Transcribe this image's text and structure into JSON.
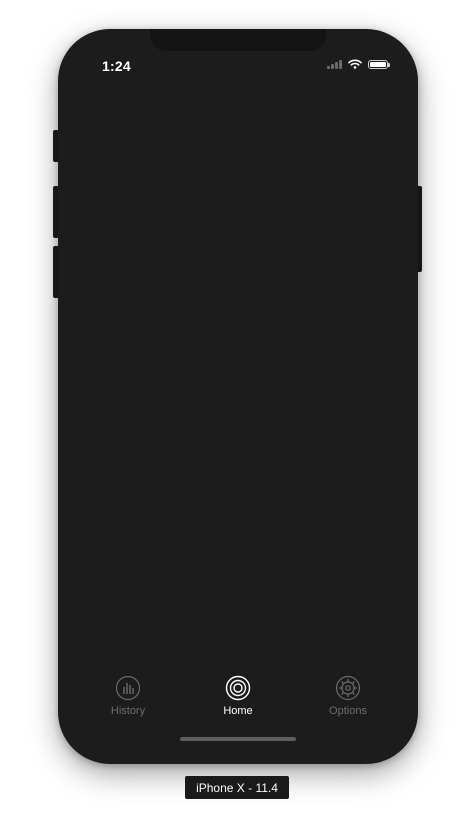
{
  "status_bar": {
    "time": "1:24",
    "icons": [
      "cellular-signal-icon",
      "wifi-icon",
      "battery-icon"
    ]
  },
  "tab_bar": {
    "tabs": [
      {
        "label": "History",
        "icon": "bar-chart-icon",
        "active": false
      },
      {
        "label": "Home",
        "icon": "target-icon",
        "active": true
      },
      {
        "label": "Options",
        "icon": "gear-icon",
        "active": false
      }
    ]
  },
  "device_label": "iPhone X - 11.4",
  "colors": {
    "screen_background": "#1c1c1c",
    "active_tab": "#ffffff",
    "inactive_tab": "#6d6d6d"
  }
}
